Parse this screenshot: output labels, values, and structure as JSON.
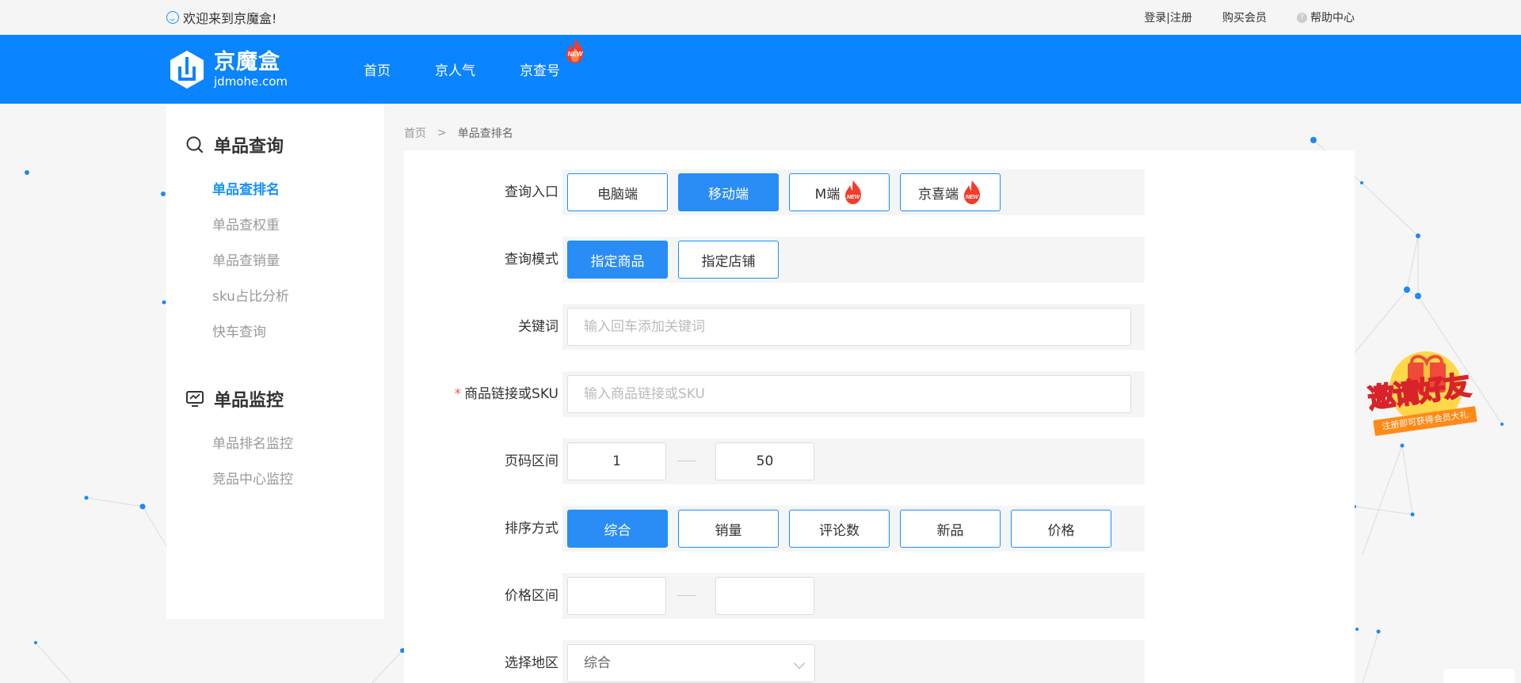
{
  "topbar": {
    "welcome": "欢迎来到京魔盒!",
    "login": "登录|注册",
    "buy_member": "购买会员",
    "help": "帮助中心"
  },
  "header": {
    "logo_cn": "京魔盒",
    "logo_en": "jdmohe.com",
    "nav": [
      "首页",
      "京人气",
      "京查号"
    ],
    "new_badge": "NEW"
  },
  "sidebar": {
    "group1": {
      "title": "单品查询",
      "items": [
        "单品查排名",
        "单品查权重",
        "单品查销量",
        "sku占比分析",
        "快车查询"
      ]
    },
    "group2": {
      "title": "单品监控",
      "items": [
        "单品排名监控",
        "竞品中心监控"
      ]
    }
  },
  "breadcrumb": {
    "home": "首页",
    "current": "单品查排名"
  },
  "form": {
    "entry": {
      "label": "查询入口",
      "options": [
        "电脑端",
        "移动端",
        "M端",
        "京喜端"
      ],
      "selected": "移动端"
    },
    "mode": {
      "label": "查询模式",
      "options": [
        "指定商品",
        "指定店铺"
      ],
      "selected": "指定商品"
    },
    "keyword": {
      "label": "关键词",
      "placeholder": "输入回车添加关键词",
      "value": ""
    },
    "sku": {
      "label": "商品链接或SKU",
      "required_mark": "*",
      "placeholder": "输入商品链接或SKU",
      "value": ""
    },
    "page_range": {
      "label": "页码区间",
      "from": "1",
      "to": "50"
    },
    "sort": {
      "label": "排序方式",
      "options": [
        "综合",
        "销量",
        "评论数",
        "新品",
        "价格"
      ],
      "selected": "综合"
    },
    "price_range": {
      "label": "价格区间",
      "from": "",
      "to": ""
    },
    "region": {
      "label": "选择地区",
      "value": "综合"
    }
  },
  "invite": {
    "title": "邀请好友",
    "subtitle": "注册即可获得会员大礼"
  },
  "colors": {
    "brand": "#0a84ff",
    "accent": "#1890ff",
    "required": "#ff4d4f"
  }
}
